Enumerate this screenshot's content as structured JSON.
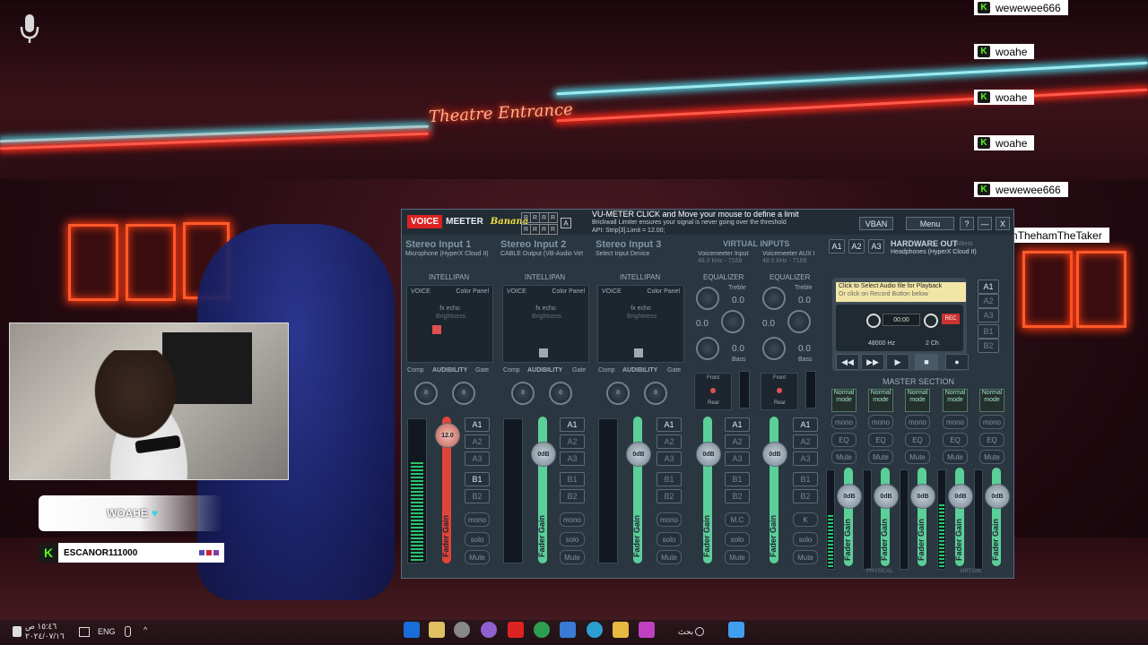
{
  "stream": {
    "neon_sign": "Theatre Entrance",
    "chat_pill": {
      "name": "",
      "message": "WOAHE",
      "heart": "♥"
    },
    "user_tag": {
      "name": "ESCANOR111000"
    },
    "feed": [
      {
        "user_icon": "K",
        "text": "wewewee666"
      },
      {
        "user_icon": "K",
        "text": "woahe"
      },
      {
        "user_icon": "K",
        "text": "woahe"
      },
      {
        "user_icon": "K",
        "text": "woahe"
      },
      {
        "user_icon": "K",
        "text": "wewewee666"
      },
      {
        "user_icon": "K",
        "text": "SamThehamTheTaker"
      }
    ]
  },
  "voicemeeter": {
    "logo": {
      "voice": "VOICE",
      "meeter": "MEETER",
      "edition": "Banana"
    },
    "r_grid": [
      "R",
      "R",
      "R",
      "R",
      "R",
      "R",
      "R",
      "R"
    ],
    "a_badge": "A",
    "info": {
      "line1": "VU-METER CLICK and Move your mouse to define a limit",
      "line2": "Brickwall Limiter ensures your signal is never going over the threshold",
      "line3": "API: Strip[3].Limit = 12.00;"
    },
    "buttons": {
      "vban": "VBAN",
      "menu": "Menu",
      "help": "?",
      "minimize": "—",
      "close": "X"
    },
    "strips": [
      {
        "title": "Stereo Input 1",
        "device": "Microphone (HyperX Cloud II)",
        "fader": "12.0",
        "fader_label": "Fader Gain"
      },
      {
        "title": "Stereo Input 2",
        "device": "CABLE Output (VB-Audio Virt",
        "fader": "0dB",
        "fader_label": "Fader Gain"
      },
      {
        "title": "Stereo Input 3",
        "device": "Select Input Device",
        "fader": "0dB",
        "fader_label": "Fader Gain"
      }
    ],
    "strip_labels": {
      "intellipan": "INTELLIPAN",
      "voice": "VOICE",
      "color_panel": "Color Panel",
      "fx_echo": "fx echo",
      "brightness": "Brightness",
      "comp": "Comp",
      "audibility": "AUDIBILITY",
      "gate": "Gate",
      "knob_value": "0"
    },
    "virtual": {
      "title": "VIRTUAL INPUTS",
      "inputs": [
        {
          "name": "Voicemeeter Input",
          "fmt": "48.0 kHz - 7168",
          "eq": "EQUALIZER",
          "fader": "0dB",
          "mc": "M.C"
        },
        {
          "name": "Voicemeeter AUX I",
          "fmt": "48.0 kHz - 7168",
          "eq": "EQUALIZER",
          "fader": "0dB",
          "mc": "K"
        }
      ],
      "treble": "Treble",
      "bass": "Bass",
      "eq_value": "0.0",
      "front": "Front",
      "rear": "Rear"
    },
    "hardware_out": {
      "title": "HARDWARE OUT",
      "fmt": "48kHz",
      "device": "Headphones (HyperX Cloud II)",
      "a_buttons": [
        "A1",
        "A2",
        "A3"
      ]
    },
    "bus_buttons": [
      "A1",
      "A2",
      "A3",
      "B1",
      "B2"
    ],
    "strip_buttons": [
      "mono",
      "solo",
      "Mute"
    ],
    "cassette": {
      "line1": "Click to Select Audio file for Playback",
      "line2": "Or click on Record Button below",
      "time": "00:00",
      "hz": "48000 Hz",
      "channels": "2 Ch",
      "record": "REC",
      "transport": [
        "◀◀",
        "▶▶",
        "▶",
        "■",
        "●"
      ],
      "bus": [
        "A1",
        "A2",
        "A3",
        "B1",
        "B2"
      ]
    },
    "master": {
      "title": "MASTER SECTION",
      "normal_mode": "Normal mode",
      "buses": [
        "A1",
        "A2",
        "A3",
        "B1",
        "B2"
      ],
      "buttons": [
        "mono",
        "EQ",
        "Mute"
      ],
      "fader": "0dB",
      "fader_label": "Fader Gain",
      "physical": "PHYSICAL",
      "virtual": "VIRTUAL"
    }
  },
  "taskbar": {
    "lang": "ENG",
    "search": "بحث",
    "time": "١٥:٤٦ ص",
    "date": "٢٠٢٤/٠٧/١٦"
  },
  "colors": {
    "fader_red": "#e0453a",
    "fader_green": "#5bcf98",
    "kick_green": "#53fc18"
  }
}
